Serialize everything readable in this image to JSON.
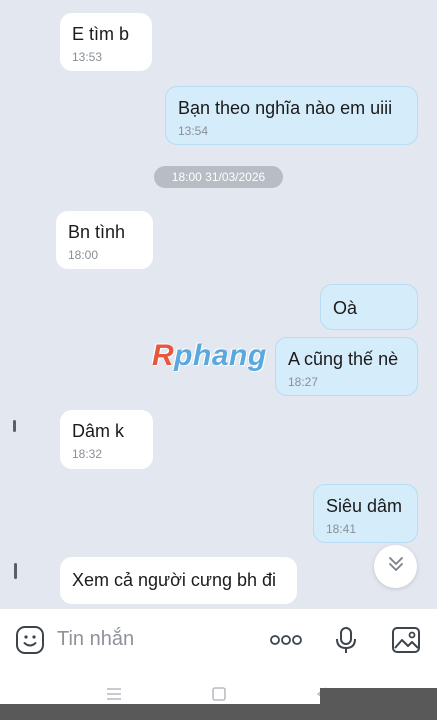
{
  "messages": [
    {
      "dir": "in",
      "text": "E tìm b",
      "time": "13:53"
    },
    {
      "dir": "out",
      "text": "Bạn theo nghĩa nào em uiii",
      "time": "13:54"
    },
    {
      "dir": "in",
      "text": "Bn tình",
      "time": "18:00"
    },
    {
      "dir": "out",
      "text": "Oà",
      "time": ""
    },
    {
      "dir": "out",
      "text": "A cũng thế nè",
      "time": "18:27"
    },
    {
      "dir": "in",
      "text": "Dâm k",
      "time": "18:32"
    },
    {
      "dir": "out",
      "text": "Siêu dâm",
      "time": "18:41"
    },
    {
      "dir": "in",
      "text": "Xem cả người cưng bh đi",
      "time": ""
    }
  ],
  "date_divider": "18:00 31/03/2026",
  "watermark": {
    "part1": "R",
    "part2": "phang"
  },
  "input": {
    "placeholder": "Tin nhắn"
  },
  "icons": {
    "emoji": "emoji-icon",
    "more": "more-options-icon",
    "mic": "microphone-icon",
    "image": "image-icon",
    "scroll_down": "chevron-double-down-icon",
    "nav_menu": "menu-icon",
    "nav_home": "home-icon",
    "nav_back": "back-icon"
  },
  "colors": {
    "background": "#e3e7ef",
    "incoming_bubble": "#ffffff",
    "outgoing_bubble": "#d5ecfb",
    "accent": "#4a90c9"
  }
}
